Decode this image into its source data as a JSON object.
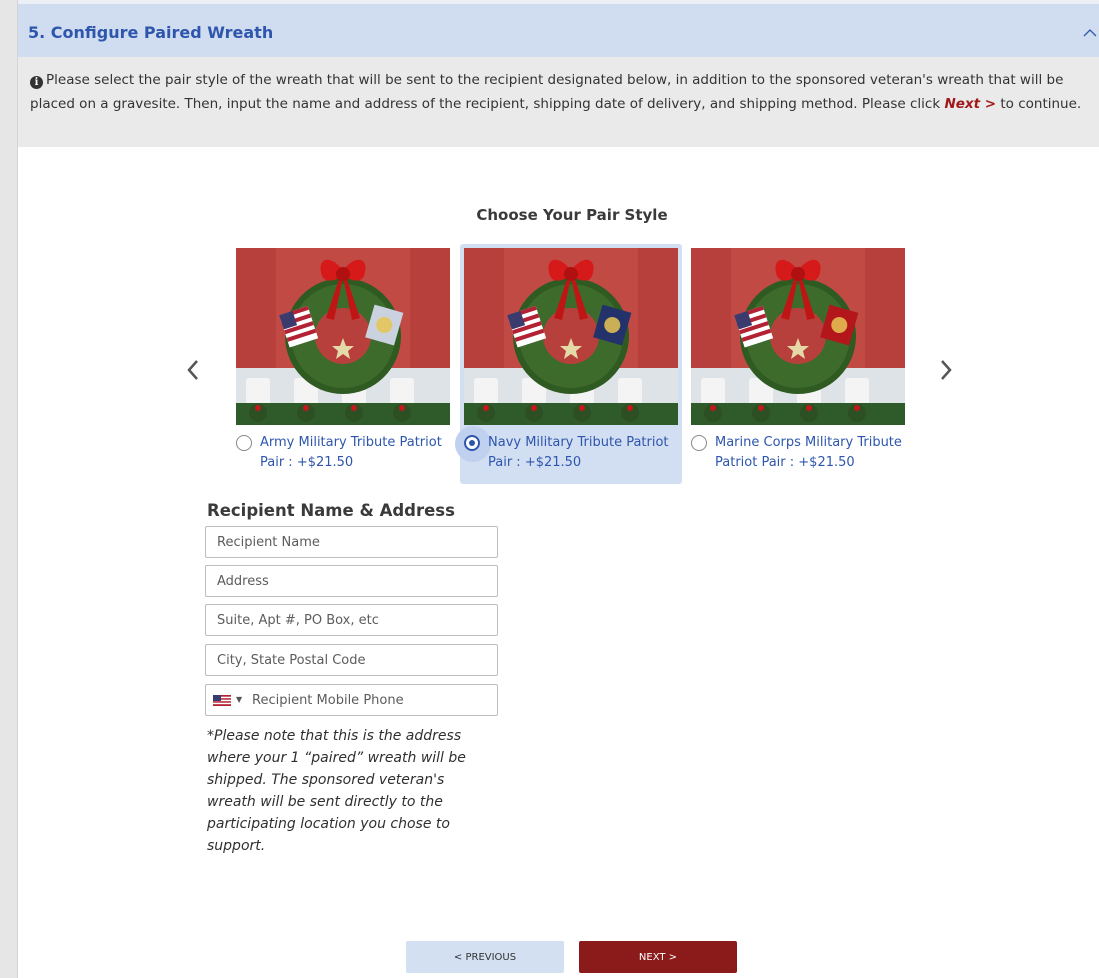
{
  "section": {
    "title": "5. Configure Paired Wreath"
  },
  "notice": {
    "text_before": "Please select the pair style of the wreath that will be sent to the recipient designated below, in addition to the sponsored veteran's wreath that will be placed on a gravesite. Then, input the name and address of the recipient, shipping date of delivery, and shipping method. Please click ",
    "next_link": "Next >",
    "text_after": " to continue."
  },
  "pair_style": {
    "title": "Choose Your Pair Style",
    "options": [
      {
        "label": "Army Military Tribute Patriot Pair : +$21.50",
        "selected": false,
        "flag_emblem_color": "#c9d2de"
      },
      {
        "label": "Navy Military Tribute Patriot Pair : +$21.50",
        "selected": true,
        "flag_emblem_color": "#23326b"
      },
      {
        "label": "Marine Corps Military Tribute Patriot Pair : +$21.50",
        "selected": false,
        "flag_emblem_color": "#b3161b"
      }
    ]
  },
  "recipient": {
    "title": "Recipient Name & Address",
    "name_placeholder": "Recipient Name",
    "address_placeholder": "Address",
    "suite_placeholder": "Suite, Apt #, PO Box, etc",
    "city_placeholder": "City, State Postal Code",
    "phone_placeholder": "Recipient Mobile Phone",
    "phone_country_icon": "us-flag-icon",
    "note": "*Please note that this is the address where your 1 “paired” wreath will be shipped. The sponsored veteran's wreath will be sent directly to the participating location you chose to support."
  },
  "buttons": {
    "previous": "< PREVIOUS",
    "next": "NEXT >"
  },
  "colors": {
    "header_bg": "#d0ddf0",
    "title_blue": "#2e56ad",
    "next_red": "#8b1a1a"
  }
}
